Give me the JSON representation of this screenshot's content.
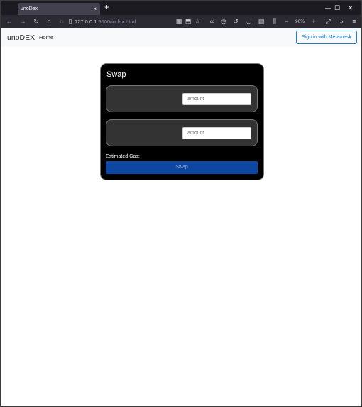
{
  "browser": {
    "tab_title": "unoDex",
    "tab_close": "×",
    "new_tab": "+",
    "minimize": "—",
    "maximize": "☐",
    "close": "✕",
    "url_host": "127.0.0.1",
    "url_path": ":5500/index.html",
    "zoom_level": "90%"
  },
  "header": {
    "brand": "unoDEX",
    "nav_home": "Home",
    "signin_label": "Sign in with Metamask"
  },
  "swap": {
    "title": "Swap",
    "from_placeholder": "amount",
    "to_placeholder": "amount",
    "gas_label": "Estimated Gas:",
    "button_label": "Swap"
  },
  "colors": {
    "card_bg": "#000000",
    "token_box_bg": "#333333",
    "swap_button": "#0d47a1",
    "signin_accent": "#1a7fc1"
  }
}
